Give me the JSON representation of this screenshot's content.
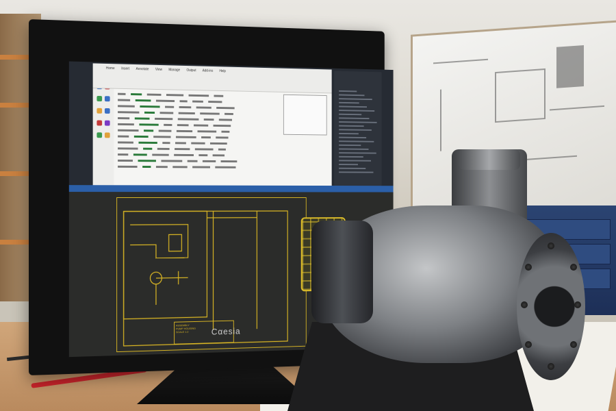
{
  "scene": {
    "description_kind": "photo",
    "monitor": {
      "brand_label": "Cαesia",
      "app_window": {
        "ribbon_tabs": [
          "Home",
          "Insert",
          "Annotate",
          "View",
          "Manage",
          "Output",
          "Add-ins",
          "Help"
        ]
      },
      "cad_drawing": {
        "title_block_lines": [
          "ASSEMBLY",
          "PUMP HOUSING",
          "SCALE 1:2"
        ]
      }
    },
    "colors": {
      "cad_line": "#d9b624",
      "cad_background": "#2b2c2a",
      "monitor_bezel": "#111111",
      "cabinet_blue": "#2b4472",
      "pencil_red": "#c8232a",
      "desk_wood": "#c69a6c"
    },
    "icons": [
      "pump-assembly-icon",
      "monitor-icon"
    ]
  }
}
